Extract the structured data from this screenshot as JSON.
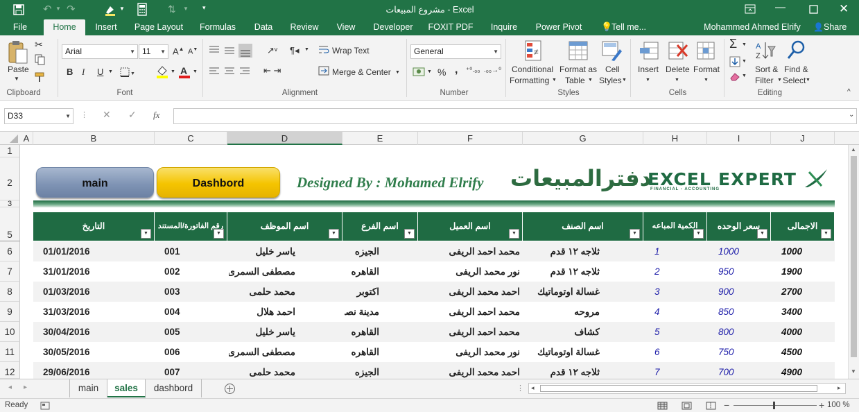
{
  "window": {
    "title": "مشروع المبيعات - Excel",
    "user": "Mohammed Ahmed Elrify",
    "share": "Share",
    "tell_me": "Tell me..."
  },
  "ribbon_tabs": [
    "File",
    "Home",
    "Insert",
    "Page Layout",
    "Formulas",
    "Data",
    "Review",
    "View",
    "Developer",
    "FOXIT PDF",
    "Inquire",
    "Power Pivot"
  ],
  "active_tab": "Home",
  "ribbon": {
    "paste": "Paste",
    "clipboard": "Clipboard",
    "font_name": "Arial",
    "font_size": "11",
    "font": "Font",
    "bold": "B",
    "italic": "I",
    "underline": "U",
    "wrap_text": "Wrap Text",
    "merge_center": "Merge & Center",
    "alignment": "Alignment",
    "number_format": "General",
    "percent": "%",
    "comma": ",",
    "number": "Number",
    "conditional_1": "Conditional",
    "conditional_2": "Formatting",
    "format_table_1": "Format as",
    "format_table_2": "Table",
    "cell_styles_1": "Cell",
    "cell_styles_2": "Styles",
    "styles": "Styles",
    "insert": "Insert",
    "delete": "Delete",
    "format": "Format",
    "cells": "Cells",
    "sort_1": "Sort &",
    "sort_2": "Filter",
    "find_1": "Find &",
    "find_2": "Select",
    "editing": "Editing"
  },
  "formula_bar": {
    "name_box": "D33",
    "formula": "",
    "fx": "fx"
  },
  "columns": [
    "A",
    "B",
    "C",
    "D",
    "E",
    "F",
    "G",
    "H",
    "I",
    "J"
  ],
  "rows": [
    "1",
    "2",
    "3",
    "5",
    "6",
    "7",
    "8",
    "9",
    "10",
    "11",
    "12"
  ],
  "banner": {
    "main_button": "main",
    "dashboard_button": "Dashbord",
    "designer": "Designed By : Mohamed Elrify",
    "arabic_title": "دفترالمبيعات",
    "logo_1": "EXCEL",
    "logo_2": "EXPERT",
    "logo_sub": "FINANCIAL - ACCOUNTING"
  },
  "table": {
    "headers": [
      "التاريخ",
      "رقم الفاتورة/المستند",
      "اسم الموظف",
      "اسم الفرع",
      "اسم العميل",
      "اسم الصنف",
      "الكمية المباعه",
      "سعر الوحده",
      "الاجمالى"
    ],
    "rows": [
      [
        "01/01/2016",
        "001",
        "ياسر خليل",
        "الجيزه",
        "محمد احمد الريفى",
        "ثلاجه ١٢ قدم",
        "1",
        "1000",
        "1000"
      ],
      [
        "31/01/2016",
        "002",
        "مصطفى السمرى",
        "القاهره",
        "نور محمد الريفى",
        "ثلاجه ١٢ قدم",
        "2",
        "950",
        "1900"
      ],
      [
        "01/03/2016",
        "003",
        "محمد حلمى",
        "اكتوبر",
        "احمد محمد الريفى",
        "غسالة اوتوماتيك",
        "3",
        "900",
        "2700"
      ],
      [
        "31/03/2016",
        "004",
        "احمد هلال",
        "مدينة نصر",
        "محمد احمد الريفى",
        "مروحه",
        "4",
        "850",
        "3400"
      ],
      [
        "30/04/2016",
        "005",
        "ياسر خليل",
        "القاهره",
        "محمد احمد الريفى",
        "كشاف",
        "5",
        "800",
        "4000"
      ],
      [
        "30/05/2016",
        "006",
        "مصطفى السمرى",
        "القاهره",
        "نور محمد الريفى",
        "غسالة اوتوماتيك",
        "6",
        "750",
        "4500"
      ],
      [
        "29/06/2016",
        "007",
        "محمد حلمى",
        "الجيزه",
        "احمد محمد الريفى",
        "ثلاجه ١٢ قدم",
        "7",
        "700",
        "4900"
      ]
    ]
  },
  "sheet_tabs": [
    "main",
    "sales",
    "dashbord"
  ],
  "active_sheet": "sales",
  "status": {
    "ready": "Ready",
    "zoom": "100 %"
  },
  "colors": {
    "excel_green": "#217346",
    "header_green": "#1f6b43",
    "qty_blue": "#1a1aa8",
    "band": "#f2f2f2"
  }
}
